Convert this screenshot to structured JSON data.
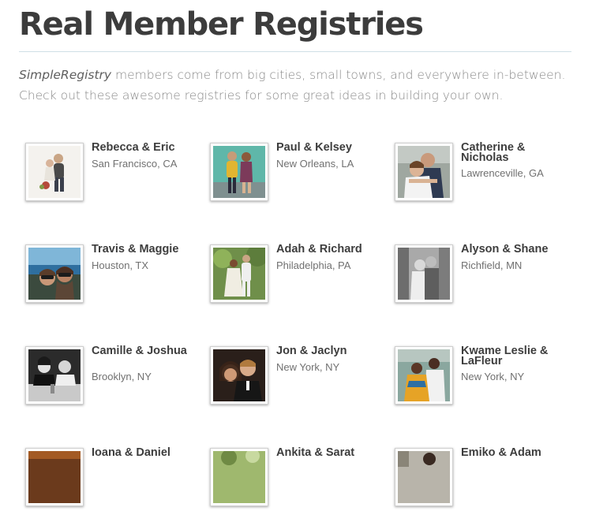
{
  "page": {
    "title": "Real Member Registries",
    "intro_brand": "SimpleRegistry",
    "intro_rest": " members come from big cities, small towns, and everywhere in-between. Check out these awesome registries for some great ideas in building your own."
  },
  "registries": [
    {
      "name": "Rebecca & Eric",
      "location": "San Francisco, CA"
    },
    {
      "name": "Paul & Kelsey",
      "location": "New Orleans, LA"
    },
    {
      "name": "Catherine & Nicholas",
      "location": "Lawrenceville, GA"
    },
    {
      "name": "Travis & Maggie",
      "location": "Houston, TX"
    },
    {
      "name": "Adah & Richard",
      "location": "Philadelphia, PA"
    },
    {
      "name": "Alyson & Shane",
      "location": "Richfield, MN"
    },
    {
      "name": "Camille & Joshua",
      "location": "Brooklyn, NY"
    },
    {
      "name": "Jon & Jaclyn",
      "location": "New York, NY"
    },
    {
      "name": "Kwame Leslie & LaFleur",
      "location": "New York, NY"
    },
    {
      "name": "Ioana & Daniel",
      "location": ""
    },
    {
      "name": "Ankita & Sarat",
      "location": ""
    },
    {
      "name": "Emiko & Adam",
      "location": ""
    }
  ]
}
